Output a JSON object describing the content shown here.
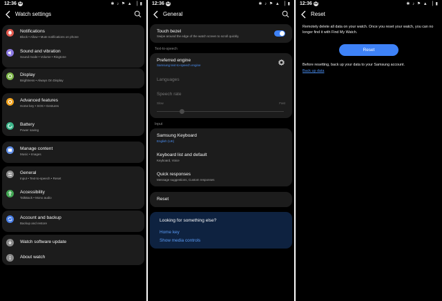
{
  "status_bar": {
    "time": "12:36",
    "badge": "12",
    "icons": "✱ ♪ ⚑ ▲ ▕ ▮"
  },
  "screen1": {
    "title": "Watch settings",
    "items": [
      {
        "title": "Notifications",
        "subtitle": "Block • Allow • Mute notifications on phone",
        "icon": "bell-icon",
        "color": "#e55b4f"
      },
      {
        "title": "Sound and vibration",
        "subtitle": "Sound mode • Volume • Ringtone",
        "icon": "speaker-icon",
        "color": "#8b79e4"
      },
      {
        "title": "Display",
        "subtitle": "Brightness • Always On Display",
        "icon": "display-icon",
        "color": "#7fb84a"
      },
      {
        "title": "Advanced features",
        "subtitle": "Home key • SOS • Gestures",
        "icon": "gear-plus-icon",
        "color": "#f2a41f"
      },
      {
        "title": "Battery",
        "subtitle": "Power saving",
        "icon": "battery-icon",
        "color": "#3bb58a"
      },
      {
        "title": "Manage content",
        "subtitle": "Music • Images",
        "icon": "folder-icon",
        "color": "#5f8ee8"
      },
      {
        "title": "General",
        "subtitle": "Input • Text-to-speech • Reset",
        "icon": "sliders-icon",
        "color": "#8e8e8e"
      },
      {
        "title": "Accessibility",
        "subtitle": "TalkBack • Mono audio",
        "icon": "accessibility-icon",
        "color": "#42a653"
      },
      {
        "title": "Account and backup",
        "subtitle": "Backup and restore",
        "icon": "sync-icon",
        "color": "#4a7fe6"
      },
      {
        "title": "Watch software update",
        "subtitle": "",
        "icon": "update-icon",
        "color": "#8a8a8a"
      },
      {
        "title": "About watch",
        "subtitle": "",
        "icon": "info-icon",
        "color": "#8a8a8a"
      }
    ]
  },
  "screen2": {
    "title": "General",
    "touch_bezel": {
      "title": "Touch bezel",
      "subtitle": "Swipe around the edge of the watch screen to scroll quickly.",
      "enabled": true
    },
    "tts_header": "Text-to-speech",
    "preferred_engine": {
      "title": "Preferred engine",
      "subtitle": "Samsung text-to-speech engine"
    },
    "languages": "Languages",
    "speech_rate": {
      "title": "Speech rate",
      "slow": "Slow",
      "fast": "Fast",
      "value": 0.2
    },
    "input_header": "Input",
    "samsung_keyboard": {
      "title": "Samsung Keyboard",
      "subtitle": "English (UK)"
    },
    "keyboard_list": {
      "title": "Keyboard list and default",
      "subtitle": "Keyboard, Voice"
    },
    "quick_responses": {
      "title": "Quick responses",
      "subtitle": "Message suggestions, Custom responses"
    },
    "reset": "Reset",
    "looking": {
      "title": "Looking for something else?",
      "links": [
        "Home key",
        "Show media controls"
      ]
    }
  },
  "screen3": {
    "title": "Reset",
    "description": "Remotely delete all data on your watch. Once you reset your watch, you can no longer find it with Find My Watch.",
    "button": "Reset",
    "note": "Before resetting, back up your data to your Samsung account.",
    "backup_link": "Back up data"
  },
  "colors": {
    "accent": "#3e82f7",
    "link": "#4a8ef2",
    "card": "#1c1c1c",
    "panel": "#0e2240"
  }
}
